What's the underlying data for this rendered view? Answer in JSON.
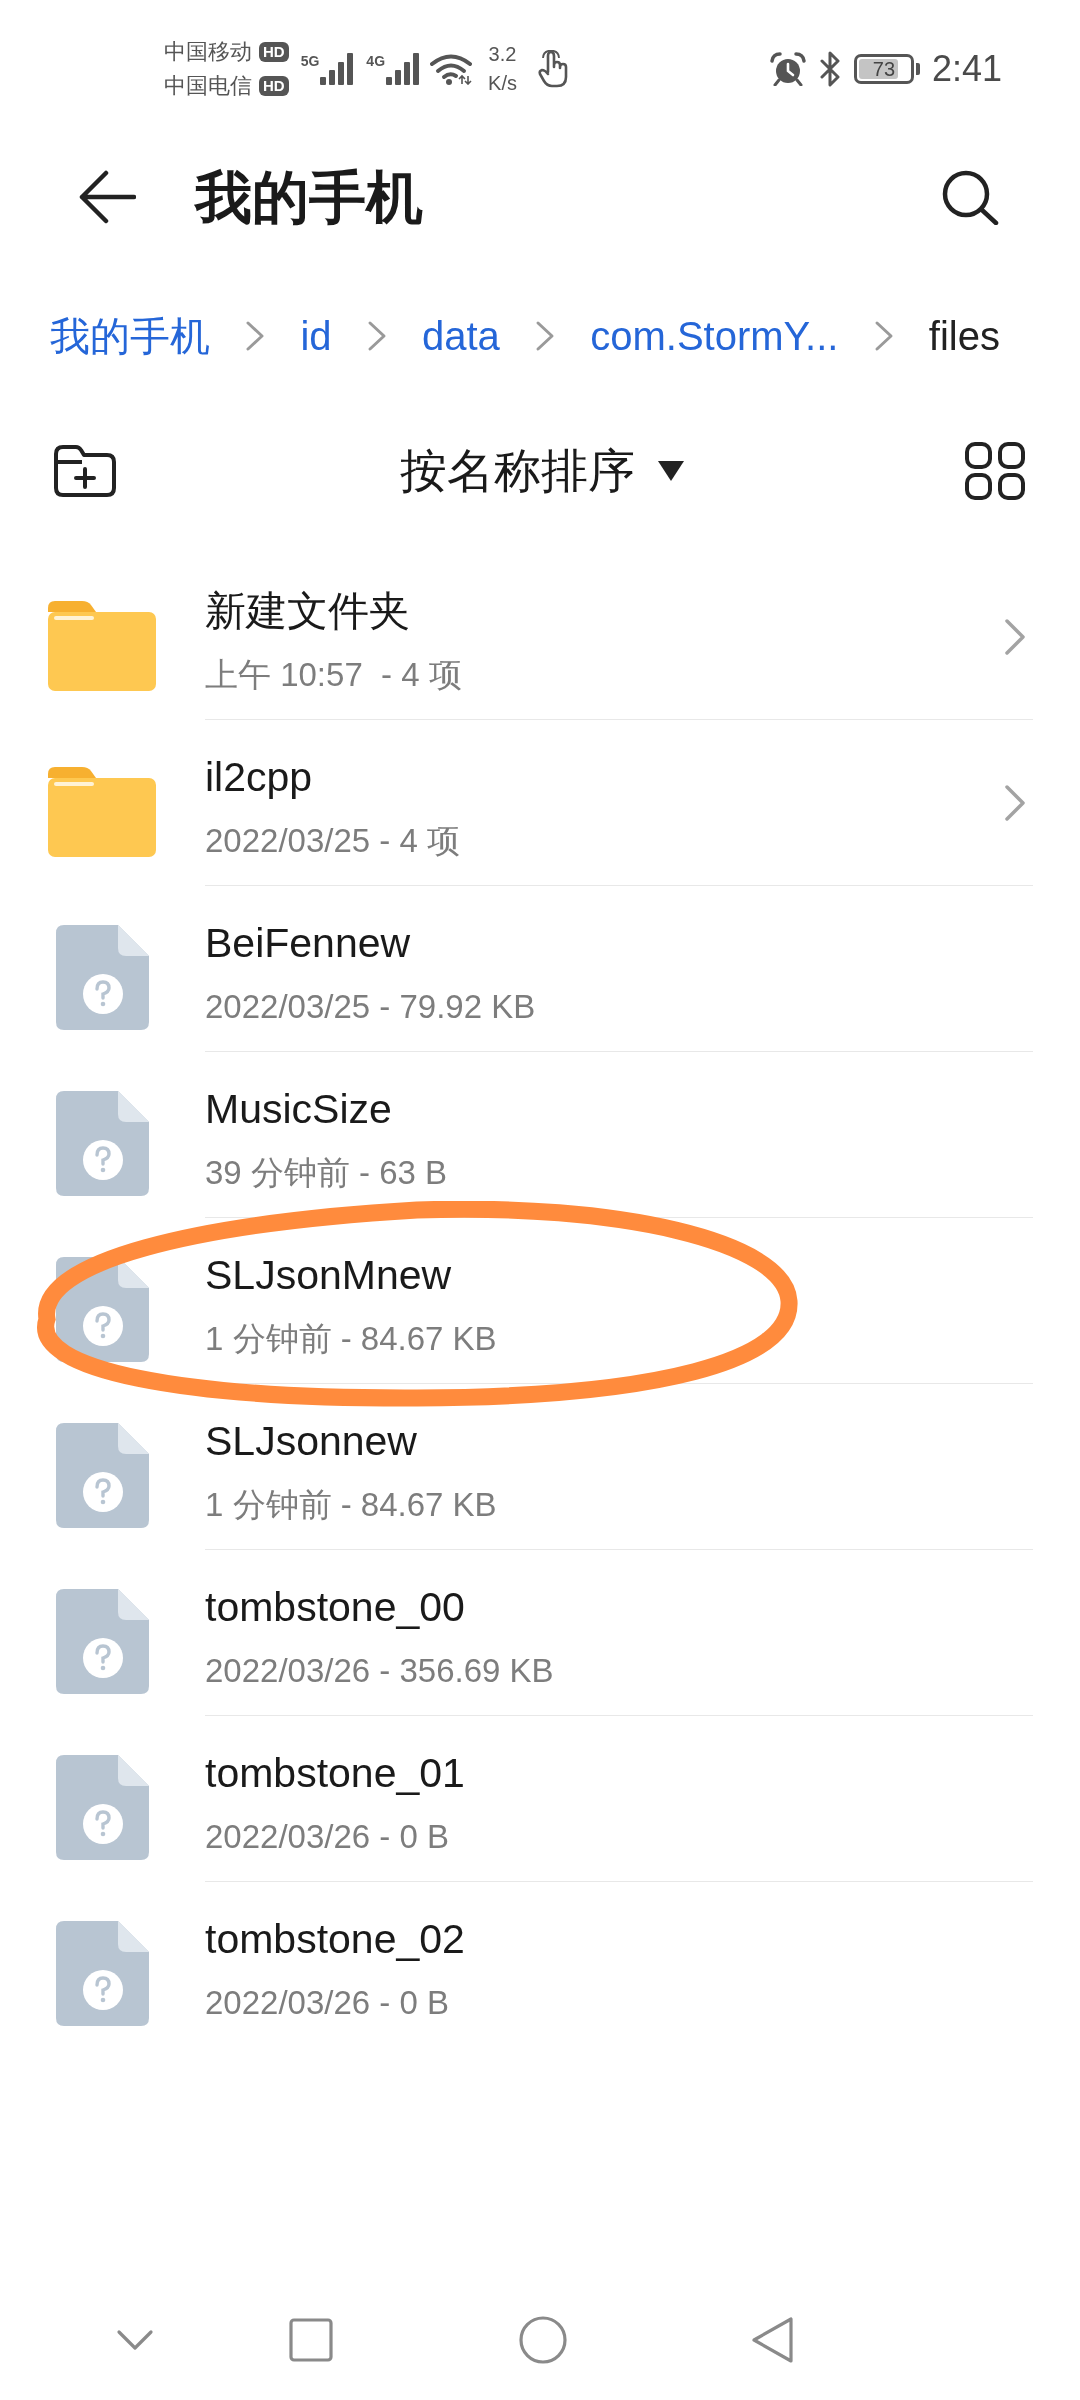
{
  "status_bar": {
    "carriers": [
      {
        "name": "中国移动",
        "badge": "HD"
      },
      {
        "name": "中国电信",
        "badge": "HD"
      }
    ],
    "signals": [
      {
        "label": "5G"
      },
      {
        "label": "4G"
      }
    ],
    "net_speed": {
      "value": "3.2",
      "unit": "K/s"
    },
    "battery": {
      "reading": "73"
    },
    "time": "2:41"
  },
  "header": {
    "title": "我的手机"
  },
  "breadcrumb": [
    {
      "label": "我的手机",
      "selected": false
    },
    {
      "label": "id",
      "selected": false
    },
    {
      "label": "data",
      "selected": false
    },
    {
      "label": "com.StormY...",
      "selected": false
    },
    {
      "label": "files",
      "selected": true
    }
  ],
  "toolbar": {
    "sort_label": "按名称排序"
  },
  "items": [
    {
      "kind": "folder",
      "name": "新建文件夹",
      "meta": "上午 10:57  - 4 项",
      "circled": false
    },
    {
      "kind": "folder",
      "name": "il2cpp",
      "meta": "2022/03/25 - 4 项",
      "circled": false
    },
    {
      "kind": "file",
      "name": "BeiFennew",
      "meta": "2022/03/25 - 79.92 KB",
      "circled": false
    },
    {
      "kind": "file",
      "name": "MusicSize",
      "meta": "39 分钟前 - 63 B",
      "circled": false
    },
    {
      "kind": "file",
      "name": "SLJsonMnew",
      "meta": "1 分钟前 - 84.67 KB",
      "circled": true
    },
    {
      "kind": "file",
      "name": "SLJsonnew",
      "meta": "1 分钟前 - 84.67 KB",
      "circled": false
    },
    {
      "kind": "file",
      "name": "tombstone_00",
      "meta": "2022/03/26 - 356.69 KB",
      "circled": false
    },
    {
      "kind": "file",
      "name": "tombstone_01",
      "meta": "2022/03/26 - 0 B",
      "circled": false
    },
    {
      "kind": "file",
      "name": "tombstone_02",
      "meta": "2022/03/26 - 0 B",
      "circled": false
    }
  ]
}
